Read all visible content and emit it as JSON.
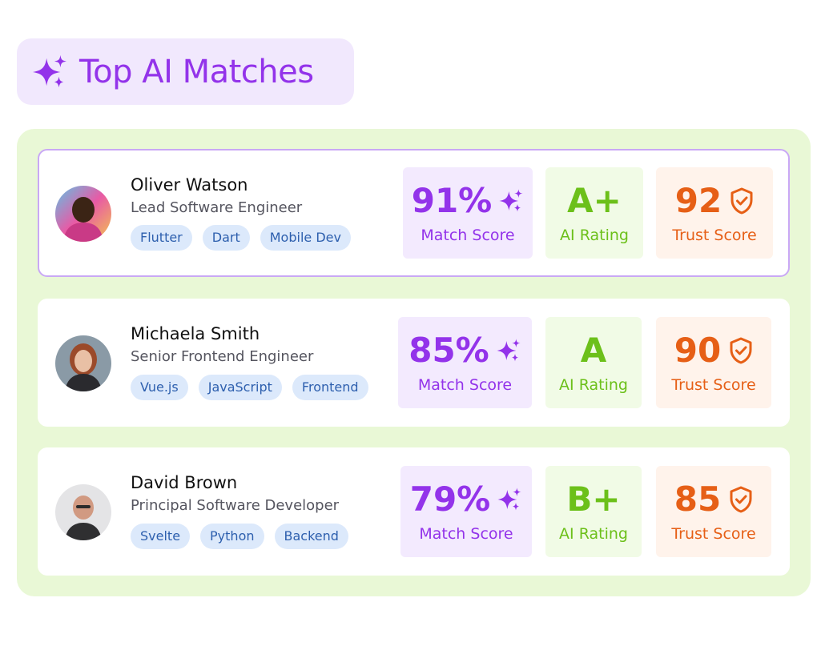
{
  "header": {
    "title": "Top AI Matches",
    "icon": "sparkle-icon"
  },
  "colors": {
    "accent_purple": "#9333ea",
    "rating_green": "#6cc01a",
    "trust_orange": "#e65f16",
    "panel_green": "#e9f8d6",
    "tag_blue": "#2d5fae"
  },
  "candidates": [
    {
      "name": "Oliver Watson",
      "role": "Lead Software Engineer",
      "tags": [
        "Flutter",
        "Dart",
        "Mobile Dev"
      ],
      "match_score": "91%",
      "match_label": "Match Score",
      "ai_rating": "A+",
      "ai_label": "AI Rating",
      "trust_score": "92",
      "trust_label": "Trust Score"
    },
    {
      "name": "Michaela Smith",
      "role": "Senior Frontend Engineer",
      "tags": [
        "Vue.js",
        "JavaScript",
        "Frontend"
      ],
      "match_score": "85%",
      "match_label": "Match Score",
      "ai_rating": "A",
      "ai_label": "AI Rating",
      "trust_score": "90",
      "trust_label": "Trust Score"
    },
    {
      "name": "David Brown",
      "role": "Principal Software Developer",
      "tags": [
        "Svelte",
        "Python",
        "Backend"
      ],
      "match_score": "79%",
      "match_label": "Match Score",
      "ai_rating": "B+",
      "ai_label": "AI Rating",
      "trust_score": "85",
      "trust_label": "Trust Score"
    }
  ]
}
